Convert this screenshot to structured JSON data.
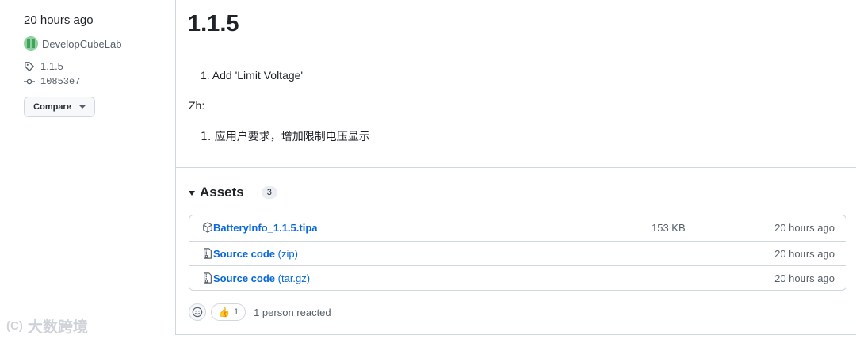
{
  "sidebar": {
    "time": "20 hours ago",
    "author": "DevelopCubeLab",
    "tag": "1.1.5",
    "commit": "10853e7",
    "compare_label": "Compare"
  },
  "release": {
    "title": "1.1.5",
    "note_en": "1. Add 'Limit Voltage'",
    "zh_label": "Zh:",
    "note_zh": "1. 应用户要求，增加限制电压显示"
  },
  "assets": {
    "title": "Assets",
    "count": "3",
    "rows": [
      {
        "name": "BatteryInfo_1.1.5.tipa",
        "ext": "",
        "size": "153 KB",
        "time": "20 hours ago",
        "icon": "package-icon"
      },
      {
        "name": "Source code",
        "ext": " (zip)",
        "size": "",
        "time": "20 hours ago",
        "icon": "file-zip-icon"
      },
      {
        "name": "Source code",
        "ext": " (tar.gz)",
        "size": "",
        "time": "20 hours ago",
        "icon": "file-zip-icon"
      }
    ]
  },
  "reactions": {
    "thumbs_count": "1",
    "text": "1 person reacted"
  },
  "watermark": {
    "logo": "(C)",
    "text": "大数跨境"
  },
  "colors": {
    "link": "#0969da",
    "muted": "#57606a",
    "border": "#d0d7de"
  }
}
